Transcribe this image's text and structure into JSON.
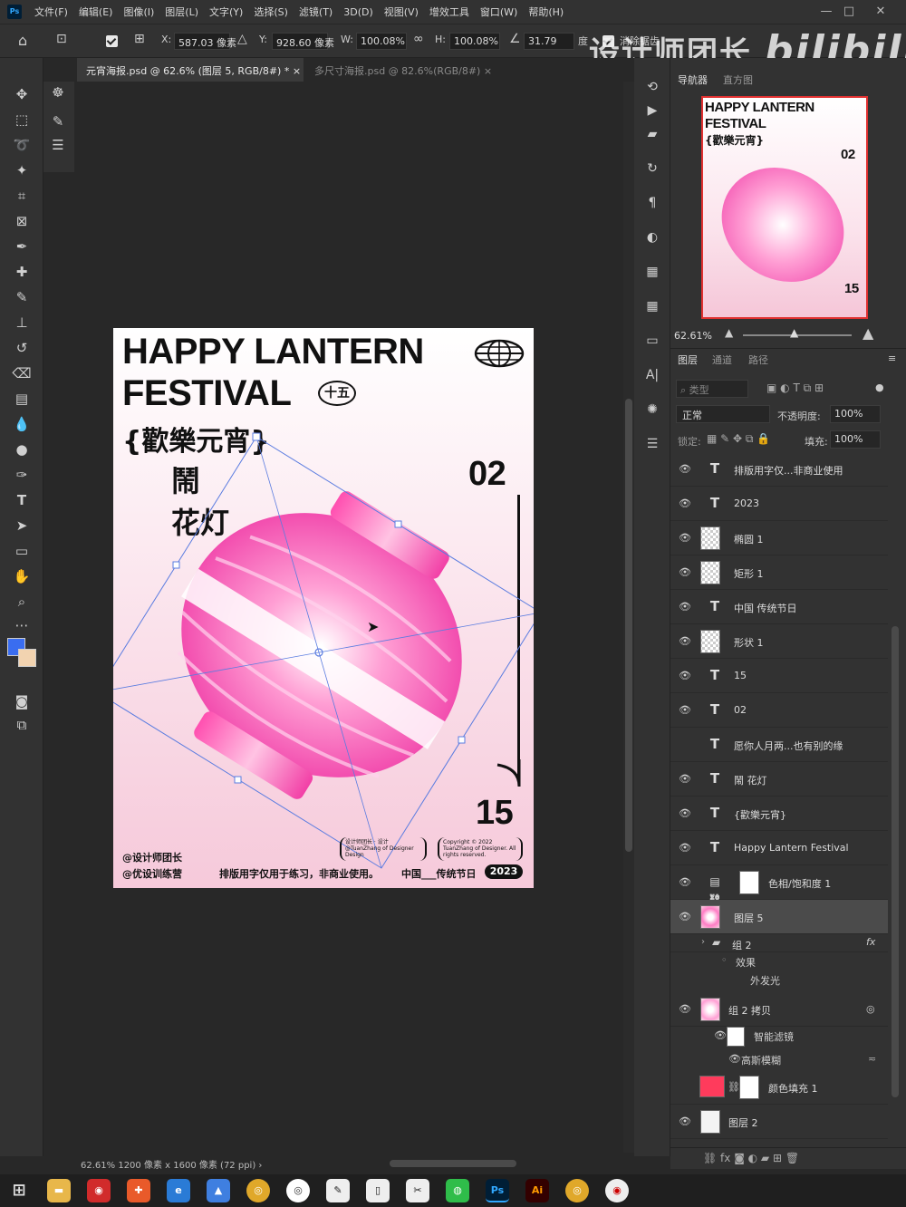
{
  "menubar": {
    "logo": "Ps",
    "items": [
      "文件(F)",
      "编辑(E)",
      "图像(I)",
      "图层(L)",
      "文字(Y)",
      "选择(S)",
      "滤镜(T)",
      "3D(D)",
      "视图(V)",
      "增效工具",
      "窗口(W)",
      "帮助(H)"
    ]
  },
  "options": {
    "x_label": "X:",
    "x_value": "587.03 像素",
    "y_label": "Y:",
    "y_value": "928.60 像素",
    "w_label": "W:",
    "w_value": "100.08%",
    "h_label": "H:",
    "h_value": "100.08%",
    "angle_value": "31.79",
    "angle_unit": "度",
    "antialias_label": "消除锯齿"
  },
  "watermark": {
    "text": "设计师团长",
    "logo": "bilibili"
  },
  "tabs": [
    {
      "label": "元宵海报.psd @ 62.6% (图层 5, RGB/8#) *",
      "close": "×"
    },
    {
      "label": "多尺寸海报.psd @ 82.6%(RGB/8#)",
      "close": "×"
    }
  ],
  "poster": {
    "title_line1": "HAPPY LANTERN",
    "title_line2": "FESTIVAL",
    "badge": "十五",
    "cn_title": "{歡樂元宵}",
    "cn_sub1": "鬧",
    "cn_sub2": "花灯",
    "month": "02",
    "day": "15",
    "credit1": "@设计师团长",
    "credit2": "@优设训练营",
    "note": "排版用字仅用于练习，非商业使用。",
    "box1": "设计师团长 · 设计 @TuanZhang of Designer Design",
    "box2": "Copyright © 2022 TuanZhang of Designer. All rights reserved.",
    "footer_label": "中国___传统节日",
    "year": "2023"
  },
  "status": {
    "zoom": "62.61%",
    "size": "1200 像素 x 1600 像素 (72 ppi)"
  },
  "navigator": {
    "tabs": [
      "导航器",
      "直方图"
    ],
    "zoom": "62.61%"
  },
  "layers_panel": {
    "tabs": [
      "图层",
      "通道",
      "路径"
    ],
    "search_placeholder": "类型",
    "blend_mode": "正常",
    "opacity_label": "不透明度:",
    "opacity_value": "100%",
    "lock_label": "锁定:",
    "fill_label": "填充:",
    "fill_value": "100%",
    "layers": [
      {
        "type": "text",
        "name": "排版用字仅...非商业使用",
        "visible": true
      },
      {
        "type": "text",
        "name": "2023",
        "visible": true
      },
      {
        "type": "shape",
        "name": "椭圆 1",
        "visible": true
      },
      {
        "type": "shape",
        "name": "矩形 1",
        "visible": true
      },
      {
        "type": "text",
        "name": "中国      传统节日",
        "visible": true
      },
      {
        "type": "shape",
        "name": "形状 1",
        "visible": true
      },
      {
        "type": "text",
        "name": "15",
        "visible": true
      },
      {
        "type": "text",
        "name": "02",
        "visible": true
      },
      {
        "type": "text",
        "name": "愿你人月两...也有别的缘",
        "visible": false
      },
      {
        "type": "text",
        "name": "鬧 花灯",
        "visible": true
      },
      {
        "type": "text",
        "name": "{歡樂元宵}",
        "visible": true
      },
      {
        "type": "text",
        "name": "Happy Lantern Festival",
        "visible": true
      },
      {
        "type": "adjust",
        "name": "色相/饱和度 1",
        "visible": true
      },
      {
        "type": "pixel",
        "name": "图层 5",
        "visible": true,
        "selected": true
      }
    ],
    "group2": {
      "name": "组 2",
      "fx": "fx",
      "effects_label": "效果",
      "effect": "外发光"
    },
    "group2copy": {
      "name": "组 2 拷贝",
      "smart_filter": "智能滤镜",
      "filter": "高斯模糊"
    },
    "fill_layer": {
      "name": "颜色填充 1",
      "color": "#ff3b5c"
    },
    "bottom_layer": {
      "name": "图层 2"
    }
  },
  "colors": {
    "foreground": "#3a6df0",
    "background": "#f2d3b0",
    "selection": "#e03030"
  }
}
